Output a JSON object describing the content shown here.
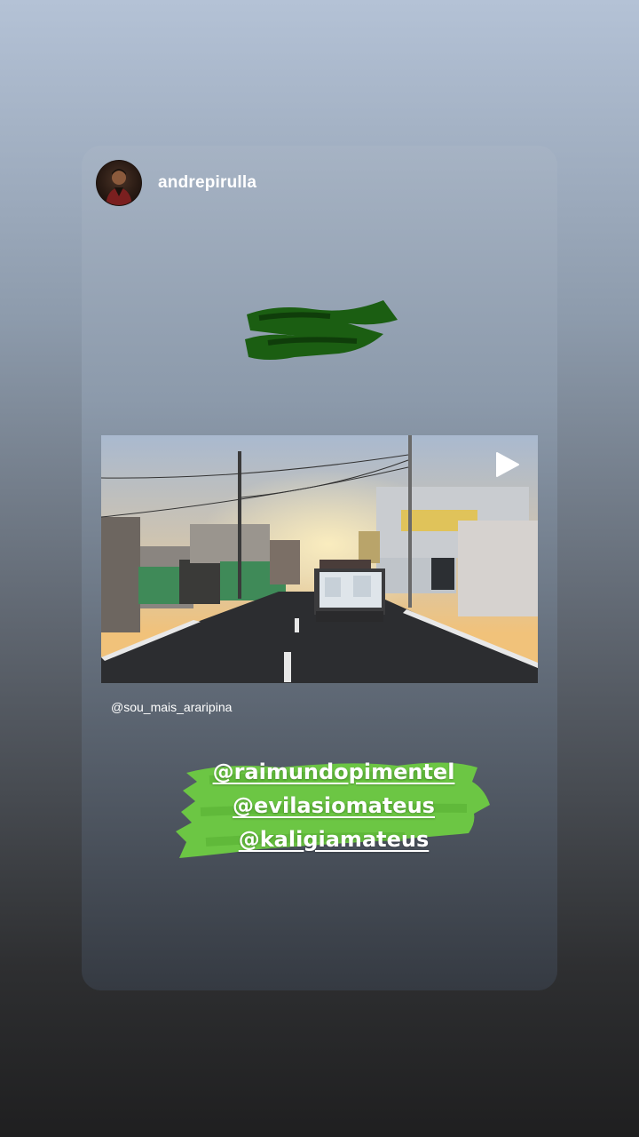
{
  "story": {
    "username": "andrepirulla",
    "credit": "@sou_mais_araripina",
    "mentions": [
      "@raimundopimentel",
      "@evilasiomateus",
      "@kaligiamateus"
    ],
    "play_icon": "play-icon"
  },
  "colors": {
    "highlight_green": "#6cc644",
    "scribble_green": "#1b5e12",
    "text": "#ffffff"
  }
}
